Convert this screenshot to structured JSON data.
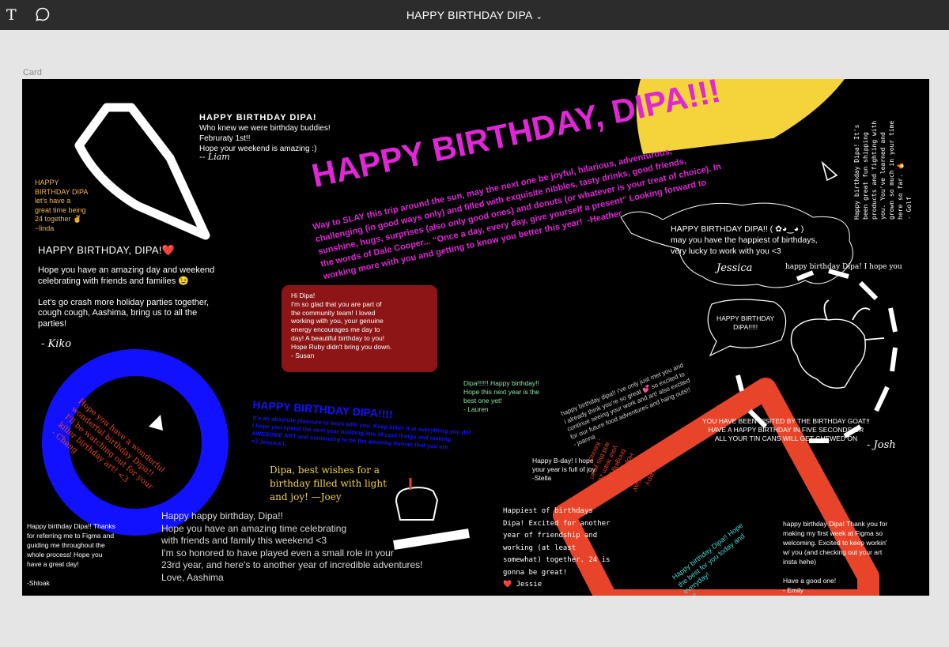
{
  "toolbar": {
    "text_tool_icon": "T",
    "comment_icon": "comment-bubble",
    "title": "HAPPY BIRTHDAY DIPA",
    "title_chevron": "⌄"
  },
  "frame_label": "Card",
  "colors": {
    "canvas": "#000000",
    "magenta": "#e026d6",
    "yellow": "#f5d33b",
    "blue": "#1111ff",
    "red_orange": "#e8442a",
    "dark_red": "#8d1515",
    "teal": "#4ad6d0",
    "mint": "#8fe0a6",
    "orange": "#f2b64d"
  },
  "notes": {
    "liam_title": "HAPPY BIRTHDAY DIPA!",
    "liam_body": "Who knew we were birthday buddies!\nFebruraty 1st!!\nHope your weekend is amazing :)",
    "liam_sig": "-- Liam",
    "linda": "HAPPY\nBIRTHDAY DIPA\nlet's have a\ngreat time being\n24 together ✌\n~linda",
    "kiko_title": "HAPPY BIRTHDAY, DIPA!❤️",
    "kiko_body": "Hope you have an amazing day and weekend\ncelebrating with friends and families 😉\n\nLet's go crash more holiday parties together,\ncough cough, Aashima, bring us to all the\nparties!",
    "kiko_sig": "- Kiko",
    "big_title": "HAPPY BIRTHDAY, DIPA!!!",
    "heather": "Way to SLAY this trip around the sun, may the next one be joyful, hilarious, adventurous,\nchallenging (in good ways only) and filled with exquisite nibbles, tasty drinks, good friends,\nsunshine, hugs, surprises (also only good ones) and donuts (or whatever is your treat of choice). In\nthe words of Dale Cooper... “Once a day, every day, give yourself a present” Looking forward to\nworking more with you and getting to know you better this year!  -Heather",
    "jessica_cloud": "HAPPY BIRTHDAY DIPA!! ( ✿◕‿◕ )\nmay you have the happiest of birthdays,\nvery lucky to work with you <3",
    "jessica_sig": "Jessica",
    "golf": "Happy birthday Dipa! It's\nbeen great fun shipping\nproducts and fighting with\nyou. You've learned and\ngrown so much in your time\nhere so far. 🔥\n- Golf",
    "truncated": "happy birthday Dipa! I hope you",
    "goat_bubble": "HAPPY BIRTHDAY\nDIPA!!!!!",
    "goat_visit": "YOU HAVE BEEN VISITED BY THE BIRTHDAY GOAT!!\nHAVE A HAPPY BIRTHDAY IN FIVE SECONDS OR\nALL YOUR TIN CANS WILL GET CHEWED ON",
    "josh_sig": "- Josh",
    "susan": "Hi Dipa!\nI'm so glad that you are part of\nthe community team! I loved\nworking with you, your genuine\nenergy encourages me day to\nday! A beautiful birthday to you!\nHope Ruby didn't bring you down.\n- Susan",
    "lauren": "Dipa!!!!!! Happy birthday!!\nHope this next year is the\nbest one yet!\n- Lauren",
    "joanna": "happy birthday dipa!! i've only just met you and\ni already think you're so great 💕 so excited to\ncontinue seeing your work and art! also excited\nfor our future food adventures and hang outs!!\n- joanna",
    "stella": "Happy B-day! I hope\nyour year is full of joy\n-Stella",
    "jessica_l_title": "HAPPY BIRTHDAY DIPA!!!!",
    "jessica_l_body": "It's an absolute pleasure to work with you. Keep killin' it at everything you do!\nI hope you spend the next year building lots of cool things and making\nAWESOME ART and continuing to be the amazing human that you are.\n<3 Jessica L",
    "chang": "Hope you have a wonderful\nwonderful birthday Dipa!!\nI'll be watching out for your\nkiller birthday art! <3\n- Chang",
    "joey": "Dipa, best wishes for a\nbirthday filled with light\nand joy!         —Joey",
    "shloak": "Happy birthday Dipa!! Thanks\nfor referring me to Figma and\nguiding me throughout the\nwhole process! Hope you\nhave a great day!\n\n-Shloak",
    "aashima": "Happy happy birthday, Dipa!!\nHope you have an amazing time celebrating\nwith friends and family this weekend <3\nI'm so honored to have played even a small role in your\n23rd year, and here's to another year of incredible adventures!\nLove, Aashima",
    "jessie": "Happiest of birthdays\nDipa! Excited for another\nyear of friendship and\nworking (at least\nsomewhat) together. 24 is\ngonna be great!\n❤️ Jessie",
    "kenrick": "HAPPY\nBIRTHDAY\nDIPA!!!!!!!!!\nHope you keep\nbringing joy to\nyour team 2020\nand this year!\n- Kenrick",
    "z_note": "Happy birthday Dipa!! Hope\nthe best for you today and\neveryday!\n- Z",
    "emily": "happy birthday Dipa! Thank you for\nmaking my first week at Figma so\nwelcoming. Excited to keep workin'\nw/ you (and checking out your art\ninsta hehe)\n\nHave a good one!\n- Emily"
  }
}
